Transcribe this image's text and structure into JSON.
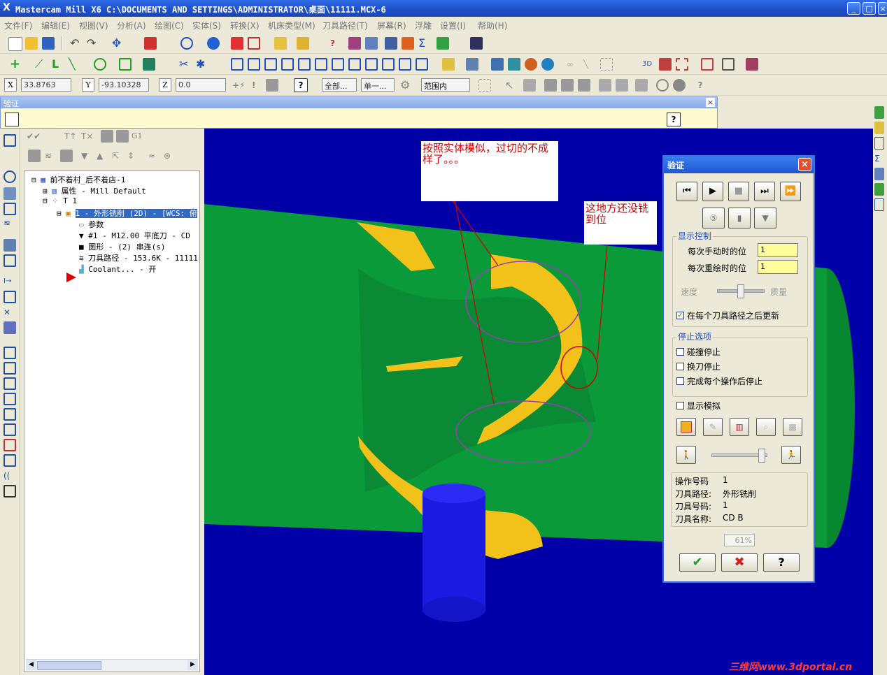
{
  "window": {
    "title": "Mastercam Mill X6  C:\\DOCUMENTS AND SETTINGS\\ADMINISTRATOR\\桌面\\11111.MCX-6"
  },
  "menu": [
    "文件(F)",
    "编辑(E)",
    "视图(V)",
    "分析(A)",
    "绘图(C)",
    "实体(S)",
    "转换(X)",
    "机床类型(M)",
    "刀具路径(T)",
    "屏幕(R)",
    "浮雕",
    "设置(I)",
    "帮助(H)"
  ],
  "coords": {
    "x_label": "X",
    "x_value": "33.8763",
    "y_label": "Y",
    "y_value": "-93.10328",
    "z_label": "Z",
    "z_value": "0.0",
    "all_label": "全部...",
    "single_label": "单一...",
    "range_label": "范围内"
  },
  "verify_bar": {
    "title": "验证",
    "help": "?"
  },
  "tree": {
    "root": "前不着村_后不着店-1",
    "items": [
      "属性 - Mill Default",
      "T 1",
      "1 - 外形铣削 (2D) - [WCS: 俯",
      "参数",
      "#1 - M12.00 平底刀 - CD",
      "图形 - (2) 串连(s)",
      "刀具路径 - 153.6K - 11111",
      "Coolant... - 开"
    ]
  },
  "annotations": {
    "note1": "按照实体模似，过切的不成样了。。。",
    "note2": "这地方还没铣到位"
  },
  "dialog": {
    "title": "验证",
    "display_group": "显示控制",
    "manual_step_label": "每次手动时的位",
    "manual_step_value": "1",
    "redraw_step_label": "每次重绘时的位",
    "redraw_step_value": "1",
    "speed_label": "速度",
    "quality_label": "质量",
    "update_after_each": "在每个刀具路径之后更新",
    "stop_group": "停止选项",
    "stop_collision": "碰撞停止",
    "stop_toolchange": "换刀停止",
    "stop_each_op": "完成每个操作后停止",
    "show_sim": "显示模拟",
    "op_no_label": "操作号码",
    "op_no_value": "1",
    "toolpath_label": "刀具路径:",
    "toolpath_value": "外形铣削",
    "tool_no_label": "刀具号码:",
    "tool_no_value": "1",
    "tool_name_label": "刀具名称:",
    "tool_name_value": "CD  B",
    "progress": "61%",
    "help": "?"
  },
  "watermark": "三维网www.3dportal.cn",
  "colors": {
    "viewport_bg": "#0000a8",
    "part": "#0a9a3a",
    "cut_face": "#f2c21a",
    "tool": "#1a1ae0",
    "highlight": "#ffff99",
    "note_text": "#d00000"
  }
}
